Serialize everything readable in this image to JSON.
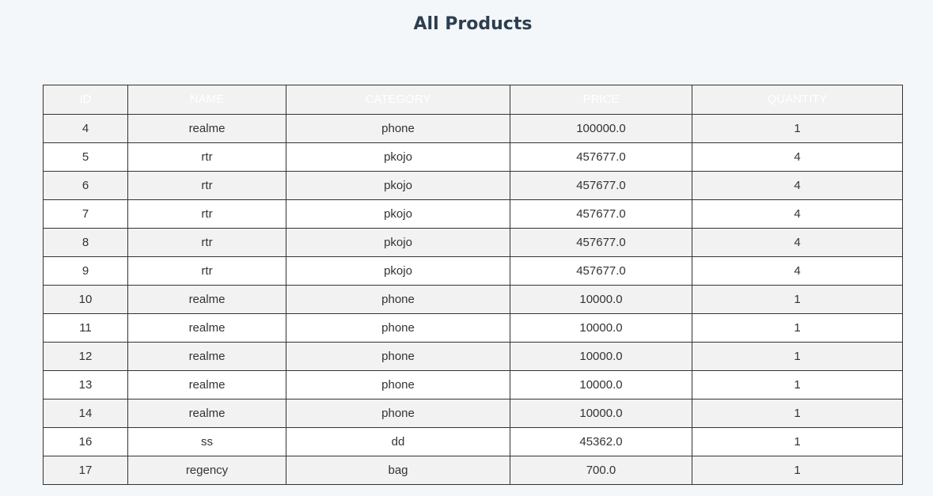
{
  "page": {
    "title": "All Products"
  },
  "table": {
    "columns": [
      "ID",
      "NAME",
      "CATEGORY",
      "PRICE",
      "QUANTITY"
    ],
    "rows": [
      [
        "4",
        "realme",
        "phone",
        "100000.0",
        "1"
      ],
      [
        "5",
        "rtr",
        "pkojo",
        "457677.0",
        "4"
      ],
      [
        "6",
        "rtr",
        "pkojo",
        "457677.0",
        "4"
      ],
      [
        "7",
        "rtr",
        "pkojo",
        "457677.0",
        "4"
      ],
      [
        "8",
        "rtr",
        "pkojo",
        "457677.0",
        "4"
      ],
      [
        "9",
        "rtr",
        "pkojo",
        "457677.0",
        "4"
      ],
      [
        "10",
        "realme",
        "phone",
        "10000.0",
        "1"
      ],
      [
        "11",
        "realme",
        "phone",
        "10000.0",
        "1"
      ],
      [
        "12",
        "realme",
        "phone",
        "10000.0",
        "1"
      ],
      [
        "13",
        "realme",
        "phone",
        "10000.0",
        "1"
      ],
      [
        "14",
        "realme",
        "phone",
        "10000.0",
        "1"
      ],
      [
        "16",
        "ss",
        "dd",
        "45362.0",
        "1"
      ],
      [
        "17",
        "regency",
        "bag",
        "700.0",
        "1"
      ]
    ]
  },
  "colors": {
    "background": "#f4f7f9",
    "title": "#2c3e50",
    "header_bg": "#f2f2f2",
    "header_text": "#ffffff",
    "row_alt": "#f2f2f2",
    "border": "#333333"
  }
}
